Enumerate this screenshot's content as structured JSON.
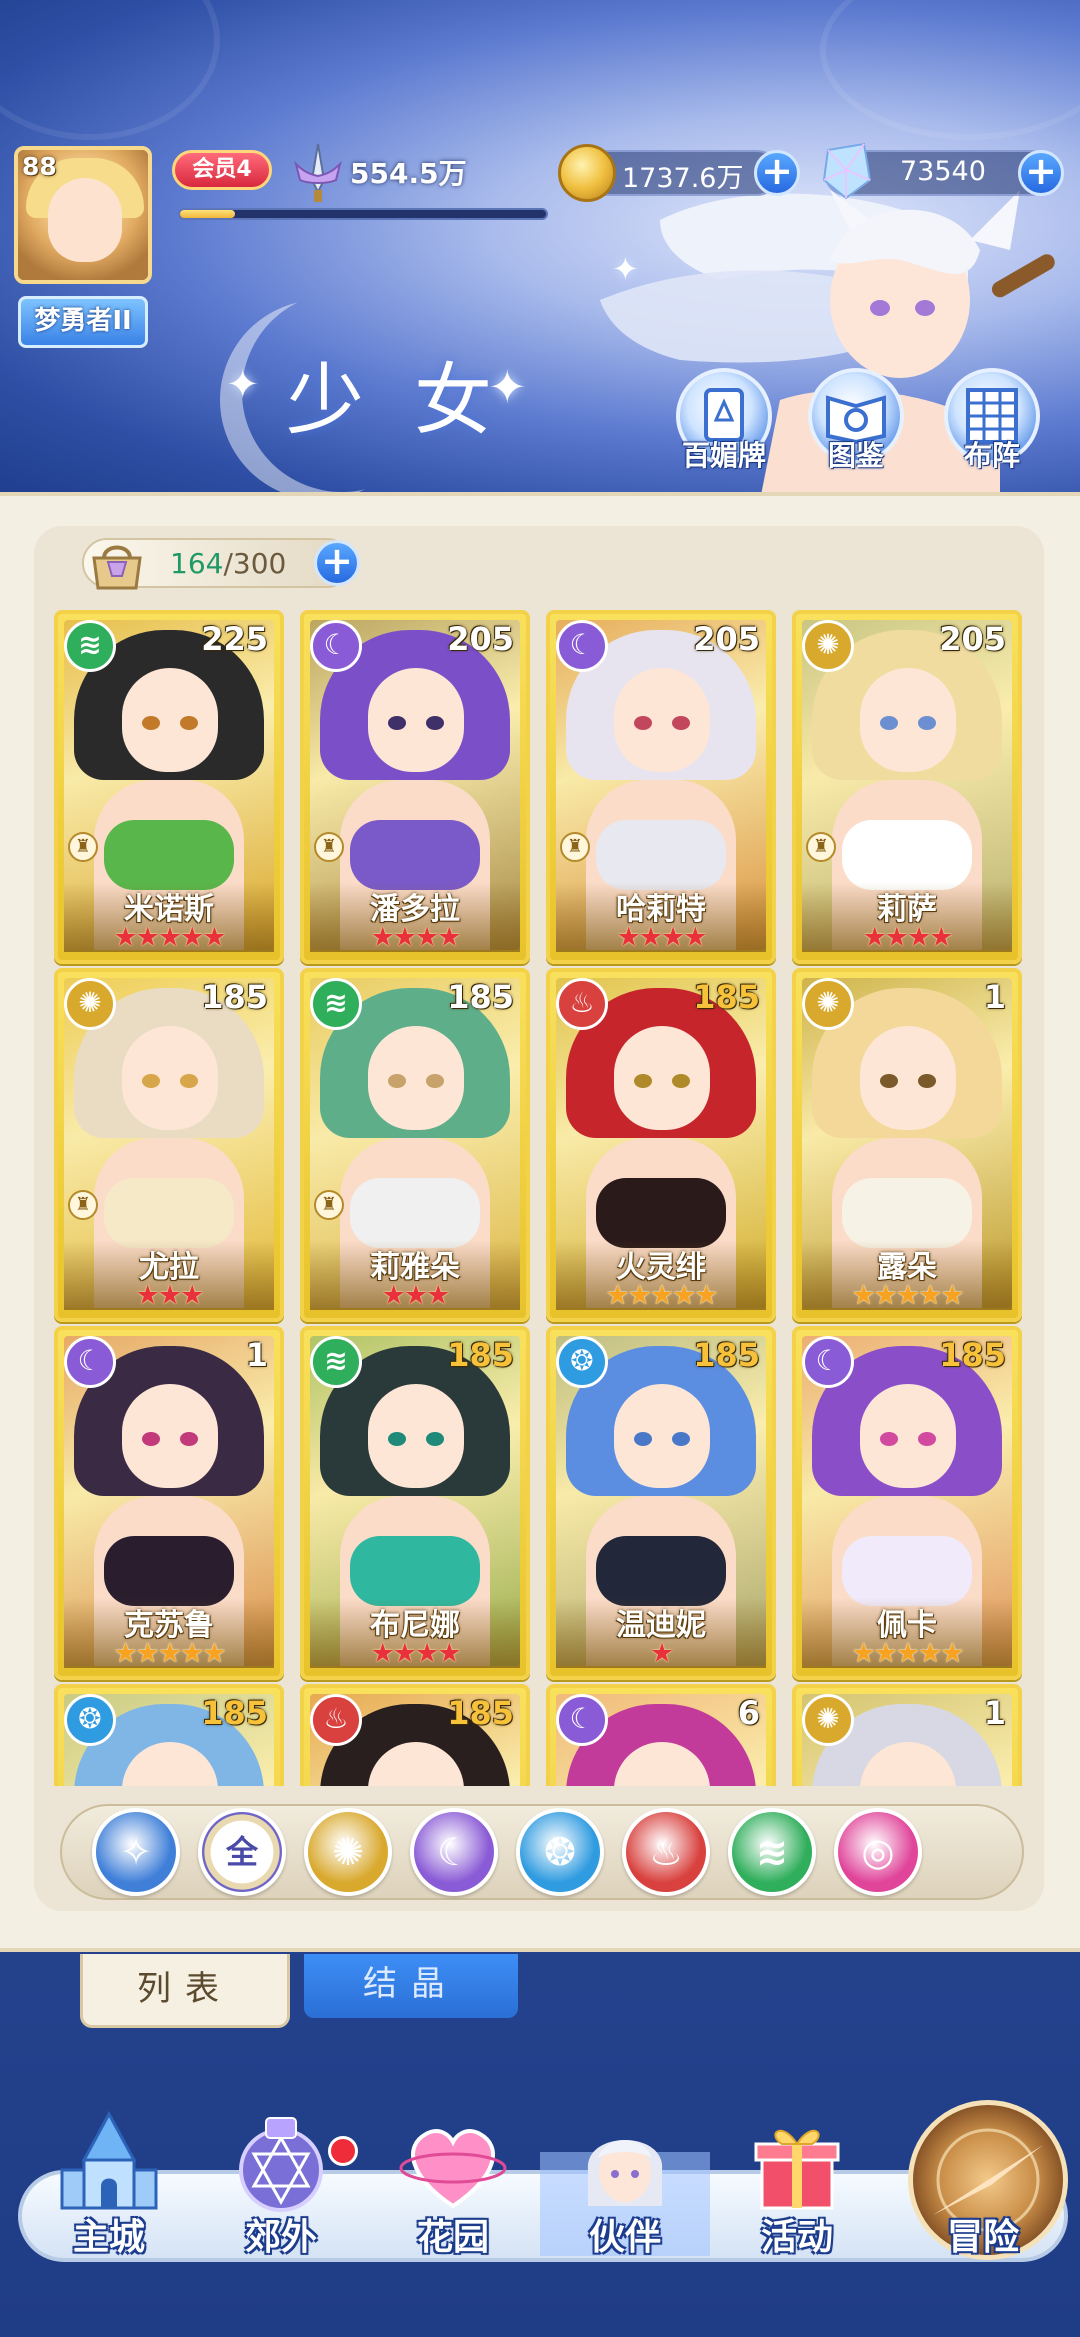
{
  "player": {
    "level": "88",
    "nickname": "梦勇者II",
    "vip": "会员4",
    "power": "554.5万",
    "power_progress": 0.15
  },
  "resources": {
    "gold": "1737.6万",
    "gems": "73540"
  },
  "header": {
    "title": "少女",
    "buttons": [
      {
        "label": "百媚牌",
        "icon": "tarot-card-icon"
      },
      {
        "label": "图鉴",
        "icon": "codex-book-icon"
      },
      {
        "label": "布阵",
        "icon": "formation-grid-icon"
      }
    ]
  },
  "capacity": {
    "current": "164",
    "max": "/300"
  },
  "cards": [
    {
      "name": "米诺斯",
      "level": "225",
      "element": "wind",
      "stars": 5,
      "star_color": "red",
      "level_color": "white",
      "locked": true
    },
    {
      "name": "潘多拉",
      "level": "205",
      "element": "moon",
      "stars": 4,
      "star_color": "red",
      "level_color": "white",
      "locked": true
    },
    {
      "name": "哈莉特",
      "level": "205",
      "element": "moon",
      "stars": 4,
      "star_color": "red",
      "level_color": "white",
      "locked": true
    },
    {
      "name": "莉萨",
      "level": "205",
      "element": "sun",
      "stars": 4,
      "star_color": "red",
      "level_color": "white",
      "locked": true
    },
    {
      "name": "尤拉",
      "level": "185",
      "element": "sun",
      "stars": 3,
      "star_color": "red",
      "level_color": "white",
      "locked": true
    },
    {
      "name": "莉雅朵",
      "level": "185",
      "element": "wind",
      "stars": 3,
      "star_color": "red",
      "level_color": "white",
      "locked": true
    },
    {
      "name": "火灵绯",
      "level": "185",
      "element": "fire",
      "stars": 5,
      "star_color": "gold",
      "level_color": "gold",
      "locked": false
    },
    {
      "name": "露朵",
      "level": "1",
      "element": "sun",
      "stars": 5,
      "star_color": "gold",
      "level_color": "white",
      "locked": false
    },
    {
      "name": "克苏鲁",
      "level": "1",
      "element": "moon",
      "stars": 5,
      "star_color": "gold",
      "level_color": "white",
      "locked": false
    },
    {
      "name": "布尼娜",
      "level": "185",
      "element": "wind",
      "stars": 4,
      "star_color": "red",
      "level_color": "gold",
      "locked": false
    },
    {
      "name": "温迪妮",
      "level": "185",
      "element": "water",
      "stars": 1,
      "star_color": "red",
      "level_color": "gold",
      "locked": false
    },
    {
      "name": "佩卡",
      "level": "185",
      "element": "moon",
      "stars": 5,
      "star_color": "gold",
      "level_color": "gold",
      "locked": false
    },
    {
      "name": "",
      "level": "185",
      "element": "water",
      "stars": 0,
      "star_color": "gold",
      "level_color": "gold",
      "locked": false
    },
    {
      "name": "",
      "level": "185",
      "element": "fire",
      "stars": 0,
      "star_color": "gold",
      "level_color": "gold",
      "locked": false
    },
    {
      "name": "",
      "level": "6",
      "element": "moon",
      "stars": 0,
      "star_color": "gold",
      "level_color": "white",
      "locked": false
    },
    {
      "name": "",
      "level": "1",
      "element": "sun",
      "stars": 0,
      "star_color": "gold",
      "level_color": "white",
      "locked": false
    }
  ],
  "filters": [
    {
      "id": "collapse",
      "label": "",
      "icon": "collapse-chevron-icon",
      "color": "#3f7fd8"
    },
    {
      "id": "all",
      "label": "全",
      "icon": "all-icon",
      "color": "#ffffff"
    },
    {
      "id": "sun",
      "label": "",
      "icon": "sun-element-icon",
      "color": "#d9a92e"
    },
    {
      "id": "moon",
      "label": "",
      "icon": "moon-element-icon",
      "color": "#8a5bd6"
    },
    {
      "id": "water",
      "label": "",
      "icon": "water-element-icon",
      "color": "#2f9be0"
    },
    {
      "id": "fire",
      "label": "",
      "icon": "fire-element-icon",
      "color": "#d8413e"
    },
    {
      "id": "wind",
      "label": "",
      "icon": "wind-element-icon",
      "color": "#2fae5b"
    },
    {
      "id": "special",
      "label": "",
      "icon": "special-element-icon",
      "color": "#e0459a"
    }
  ],
  "tabs": {
    "list": "列表",
    "crystal": "结晶"
  },
  "nav": [
    {
      "label": "主城",
      "icon": "castle-icon"
    },
    {
      "label": "郊外",
      "icon": "magic-circle-icon"
    },
    {
      "label": "花园",
      "icon": "heart-garden-icon"
    },
    {
      "label": "伙伴",
      "icon": "partner-portrait-icon"
    },
    {
      "label": "活动",
      "icon": "gift-box-icon"
    },
    {
      "label": "冒险",
      "icon": "compass-icon"
    }
  ],
  "colors": {
    "card_gold": "#f3d24a",
    "elem_wind": "#2fae5b",
    "elem_moon": "#8a5bd6",
    "elem_sun": "#d9a92e",
    "elem_fire": "#d8413e",
    "elem_water": "#2f9be0"
  }
}
